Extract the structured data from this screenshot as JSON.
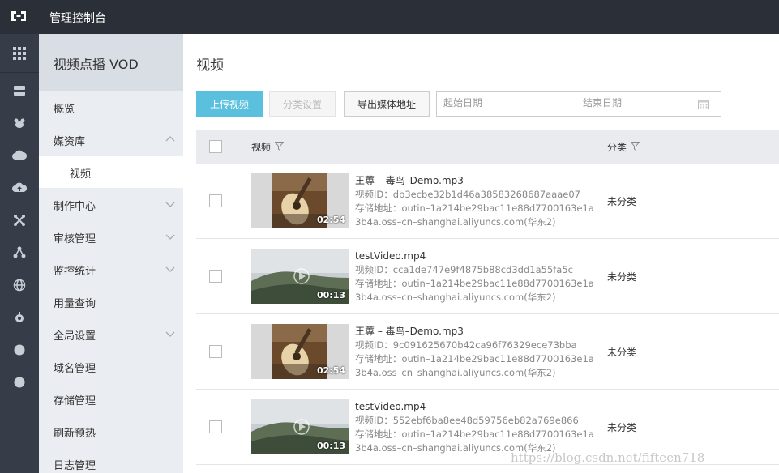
{
  "app": {
    "title": "管理控制台"
  },
  "iconbar": {
    "icons": [
      "grid-icon",
      "server-icon",
      "paw-icon",
      "cloud-icon",
      "cloud-upload-icon",
      "nodes-icon",
      "share-icon",
      "globe-icon",
      "settings-icon",
      "dot-icon",
      "dot-icon"
    ]
  },
  "sidebar": {
    "title": "视频点播 VOD",
    "items": [
      {
        "label": "概览"
      },
      {
        "label": "媒资库"
      },
      {
        "label": "视频"
      },
      {
        "label": "制作中心"
      },
      {
        "label": "审核管理"
      },
      {
        "label": "监控统计"
      },
      {
        "label": "用量查询"
      },
      {
        "label": "全局设置"
      },
      {
        "label": "域名管理"
      },
      {
        "label": "存储管理"
      },
      {
        "label": "刷新预热"
      },
      {
        "label": "日志管理"
      }
    ]
  },
  "main": {
    "title": "视频",
    "toolbar": {
      "upload_label": "上传视频",
      "category_label": "分类设置",
      "export_label": "导出媒体地址",
      "start_placeholder": "起始日期",
      "separator": "-",
      "end_placeholder": "结束日期"
    },
    "table": {
      "headers": {
        "video": "视频",
        "category": "分类"
      },
      "rows": [
        {
          "duration": "02:54",
          "title": "王蓴 – 毒鸟–Demo.mp3",
          "video_id": "视频ID：db3ecbe32b1d46a38583268687aaae07",
          "storage_line1": "存储地址：outin–1a214be29bac11e88d7700163e1a",
          "storage_line2": "3b4a.oss–cn–shanghai.aliyuncs.com(华东2)",
          "category": "未分类",
          "thumb": "guitar"
        },
        {
          "duration": "00:13",
          "title": "testVideo.mp4",
          "video_id": "视频ID：cca1de747e9f4875b88cd3dd1a55fa5c",
          "storage_line1": "存储地址：outin–1a214be29bac11e88d7700163e1a",
          "storage_line2": "3b4a.oss–cn–shanghai.aliyuncs.com(华东2)",
          "category": "未分类",
          "thumb": "landscape"
        },
        {
          "duration": "02:54",
          "title": "王蓴 – 毒鸟–Demo.mp3",
          "video_id": "视频ID：9c091625670b42ca96f76329ece73bba",
          "storage_line1": "存储地址：outin–1a214be29bac11e88d7700163e1a",
          "storage_line2": "3b4a.oss–cn–shanghai.aliyuncs.com(华东2)",
          "category": "未分类",
          "thumb": "guitar"
        },
        {
          "duration": "00:13",
          "title": "testVideo.mp4",
          "video_id": "视频ID：552ebf6ba8ee48d59756eb82a769e866",
          "storage_line1": "存储地址：outin–1a214be29bac11e88d7700163e1a",
          "storage_line2": "3b4a.oss–cn–shanghai.aliyuncs.com(华东2)",
          "category": "未分类",
          "thumb": "landscape"
        }
      ]
    }
  },
  "watermark": "https://blog.csdn.net/fifteen718"
}
